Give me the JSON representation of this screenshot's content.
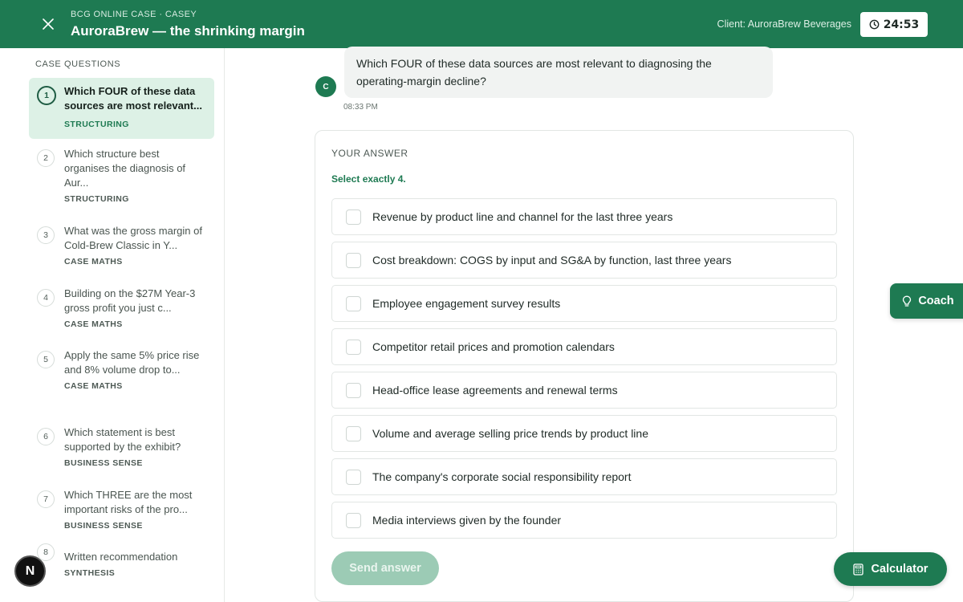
{
  "header": {
    "eyebrow": "BCG ONLINE CASE · CASEY",
    "title": "AuroraBrew — the shrinking margin",
    "client": "Client: AuroraBrew Beverages",
    "timer": "24:53"
  },
  "sidebar": {
    "title": "CASE QUESTIONS",
    "questions": [
      {
        "num": "1",
        "text": "Which FOUR of these data sources are most relevant...",
        "tag": "STRUCTURING",
        "active": true
      },
      {
        "num": "2",
        "text": "Which structure best organises the diagnosis of Aur...",
        "tag": "STRUCTURING"
      },
      {
        "num": "3",
        "text": "What was the gross margin of Cold-Brew Classic in Y...",
        "tag": "CASE MATHS"
      },
      {
        "num": "4",
        "text": "Building on the $27M Year-3 gross profit you just c...",
        "tag": "CASE MATHS"
      },
      {
        "num": "5",
        "text": "Apply the same 5% price rise and 8% volume drop to...",
        "tag": "CASE MATHS"
      },
      {
        "num": "6",
        "text": "Which statement is best supported by the exhibit?",
        "tag": "BUSINESS SENSE"
      },
      {
        "num": "7",
        "text": "Which THREE are the most important risks of the pro...",
        "tag": "BUSINESS SENSE"
      },
      {
        "num": "8",
        "text": "Written recommendation",
        "tag": "SYNTHESIS"
      }
    ]
  },
  "badge": {
    "letter": "N"
  },
  "chat": {
    "avatar": "C",
    "message": "Which FOUR of these data sources are most relevant to diagnosing the operating-margin decline?",
    "time": "08:33 PM"
  },
  "answer": {
    "label": "YOUR ANSWER",
    "hint": "Select exactly 4.",
    "options": [
      "Revenue by product line and channel for the last three years",
      "Cost breakdown: COGS by input and SG&A by function, last three years",
      "Employee engagement survey results",
      "Competitor retail prices and promotion calendars",
      "Head-office lease agreements and renewal terms",
      "Volume and average selling price trends by product line",
      "The company's corporate social responsibility report",
      "Media interviews given by the founder"
    ],
    "send_label": "Send answer"
  },
  "coach": {
    "label": "Coach"
  },
  "calculator": {
    "label": "Calculator"
  },
  "colors": {
    "brand": "#1e7a52",
    "active_bg": "#ddf1e6",
    "send_disabled": "#9ccbb5"
  }
}
